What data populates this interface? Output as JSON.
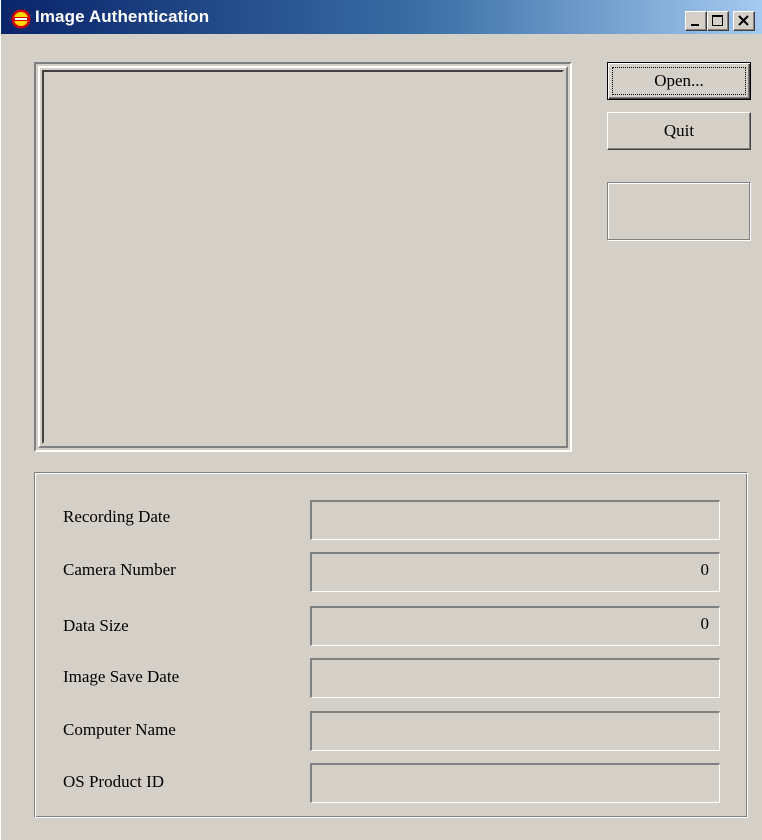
{
  "window": {
    "title": "Image Authentication",
    "icon": "app-badge-icon",
    "controls": {
      "minimize": "minimize-icon",
      "maximize": "maximize-icon",
      "close": "close-icon"
    }
  },
  "buttons": {
    "open_label": "Open...",
    "quit_label": "Quit"
  },
  "fields": [
    {
      "label": "Recording Date",
      "value": ""
    },
    {
      "label": "Camera Number",
      "value": "0"
    },
    {
      "label": "Data Size",
      "value": "0"
    },
    {
      "label": "Image Save Date",
      "value": ""
    },
    {
      "label": "Computer Name",
      "value": ""
    },
    {
      "label": "OS Product ID",
      "value": ""
    }
  ],
  "colors": {
    "face": "#d4d0c8",
    "title_start": "#0a246a",
    "title_end": "#a6caf0",
    "title_text": "#ffffff"
  }
}
